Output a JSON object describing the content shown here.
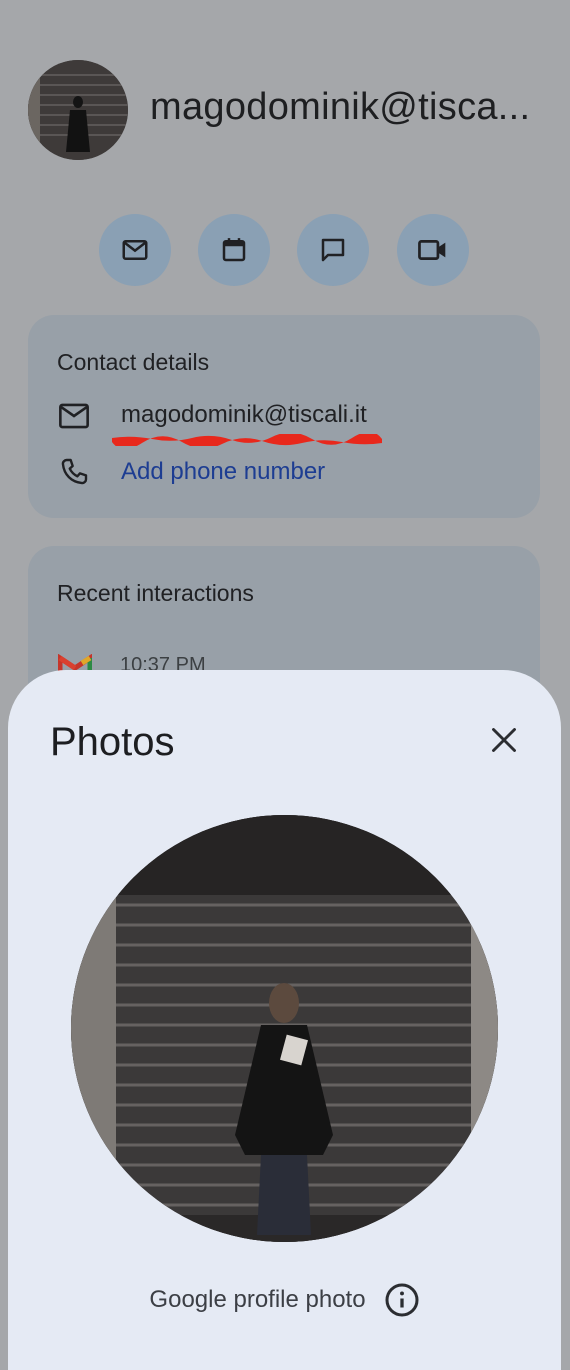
{
  "contact": {
    "name": "magodominik@tisca...",
    "email": "magodominik@tiscali.it",
    "add_phone_label": "Add phone number"
  },
  "actions": {
    "email_icon": "mail-icon",
    "calendar_icon": "calendar-icon",
    "chat_icon": "chat-icon",
    "video_icon": "video-icon"
  },
  "contact_details": {
    "title": "Contact details"
  },
  "recent": {
    "title": "Recent interactions",
    "time": "10:37 PM"
  },
  "photos_sheet": {
    "title": "Photos",
    "caption": "Google profile photo"
  },
  "colors": {
    "accent_link": "#1d3d92",
    "action_button": "#8aa0b4",
    "sheet_bg": "#e5eaf4",
    "redaction": "#e8281c"
  }
}
